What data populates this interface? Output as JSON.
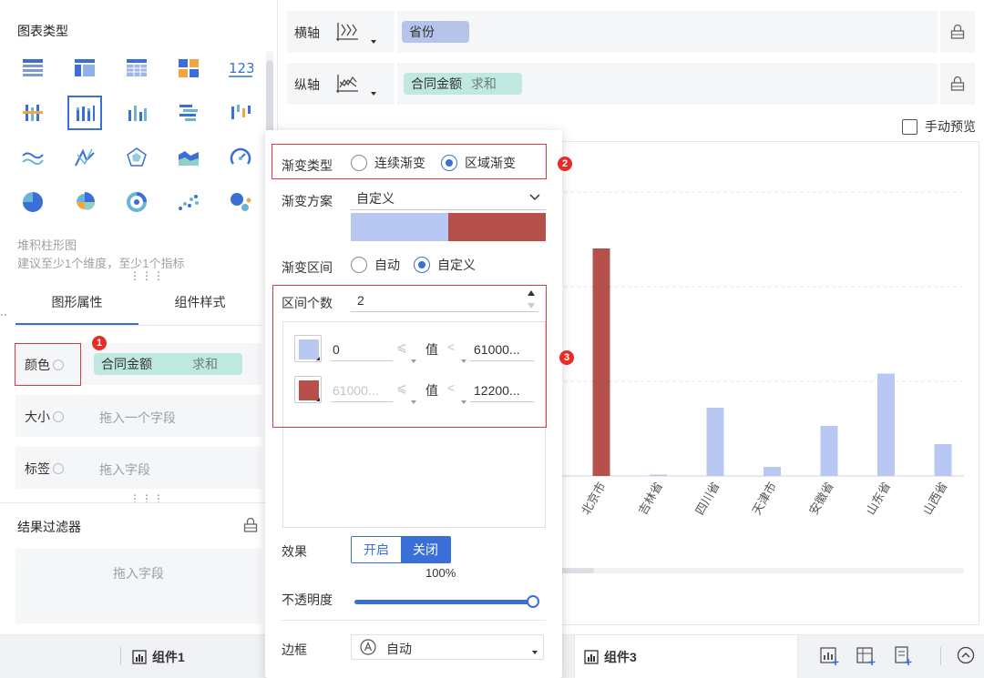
{
  "left_panel": {
    "chart_type_title": "图表类型",
    "selected_chart_name": "堆积柱形图",
    "chart_hint": "建议至少1个维度，至少1个指标",
    "chart_icons": [
      "table-icon",
      "cross-table-icon",
      "detail-table-icon",
      "kpi-block-icon",
      "number-card-icon",
      "grouped-bar-icon",
      "stacked-column-icon",
      "column-icon",
      "horizontal-bar-icon",
      "waterfall-icon",
      "line-icon",
      "radar-line-icon",
      "radar-icon",
      "area-icon",
      "gauge-icon",
      "pie-icon",
      "rose-pie-icon",
      "ring-icon",
      "scatter-icon",
      "bubble-icon"
    ],
    "tabs": {
      "shape_props": "图形属性",
      "component_style": "组件样式"
    },
    "props": {
      "color": {
        "label": "颜色",
        "field": "合同金额",
        "agg": "求和"
      },
      "size": {
        "label": "大小",
        "placeholder": "拖入一个字段"
      },
      "label": {
        "label": "标签",
        "placeholder": "拖入字段"
      }
    },
    "filter": {
      "title": "结果过滤器",
      "placeholder": "拖入字段"
    },
    "badge1": "1"
  },
  "axes": {
    "x": {
      "label": "横轴",
      "field": "省份"
    },
    "y": {
      "label": "纵轴",
      "field": "合同金额",
      "agg": "求和"
    }
  },
  "preview_label": "手动预览",
  "chart_data": {
    "type": "bar",
    "categories": [
      "北京市",
      "吉林省",
      "四川省",
      "天津市",
      "安徽省",
      "山东省",
      "山西省"
    ],
    "values": [
      1.0,
      0.005,
      0.3,
      0.04,
      0.22,
      0.45,
      0.14
    ],
    "bar_colors": [
      "#b6504a",
      "#b8c8f2",
      "#b8c8f2",
      "#b8c8f2",
      "#b8c8f2",
      "#b8c8f2",
      "#b8c8f2"
    ]
  },
  "popup": {
    "gradient_type_label": "渐变类型",
    "gradient_type_options": [
      "连续渐变",
      "区域渐变"
    ],
    "gradient_scheme_label": "渐变方案",
    "gradient_scheme_value": "自定义",
    "gradient_colors": [
      "#b8c8f2",
      "#b6504a"
    ],
    "gradient_range_label": "渐变区间",
    "gradient_range_options": [
      "自动",
      "自定义"
    ],
    "interval_count_label": "区间个数",
    "interval_count_value": "2",
    "intervals": [
      {
        "color": "#b8c8f2",
        "from": "0",
        "cmp1": "⩽",
        "value": "值",
        "cmp2": "<",
        "to": "61000..."
      },
      {
        "color": "#b6504a",
        "from": "61000...",
        "cmp1": "⩽",
        "value": "值",
        "cmp2": "<",
        "to": "12200..."
      }
    ],
    "effect_label": "效果",
    "effect_on": "开启",
    "effect_off": "关闭",
    "opacity_percent": "100%",
    "opacity_label": "不透明度",
    "border_label": "边框",
    "border_value": "自动",
    "badge2": "2",
    "badge3": "3"
  },
  "bottom_bar": {
    "tab1": "组件1",
    "tab3": "组件3"
  },
  "colors": {
    "accent": "#3a6fd8",
    "highlight_red": "#e0383e",
    "field_pill_x": "#b5c4ea",
    "field_pill_measure": "#bfe8e0"
  }
}
